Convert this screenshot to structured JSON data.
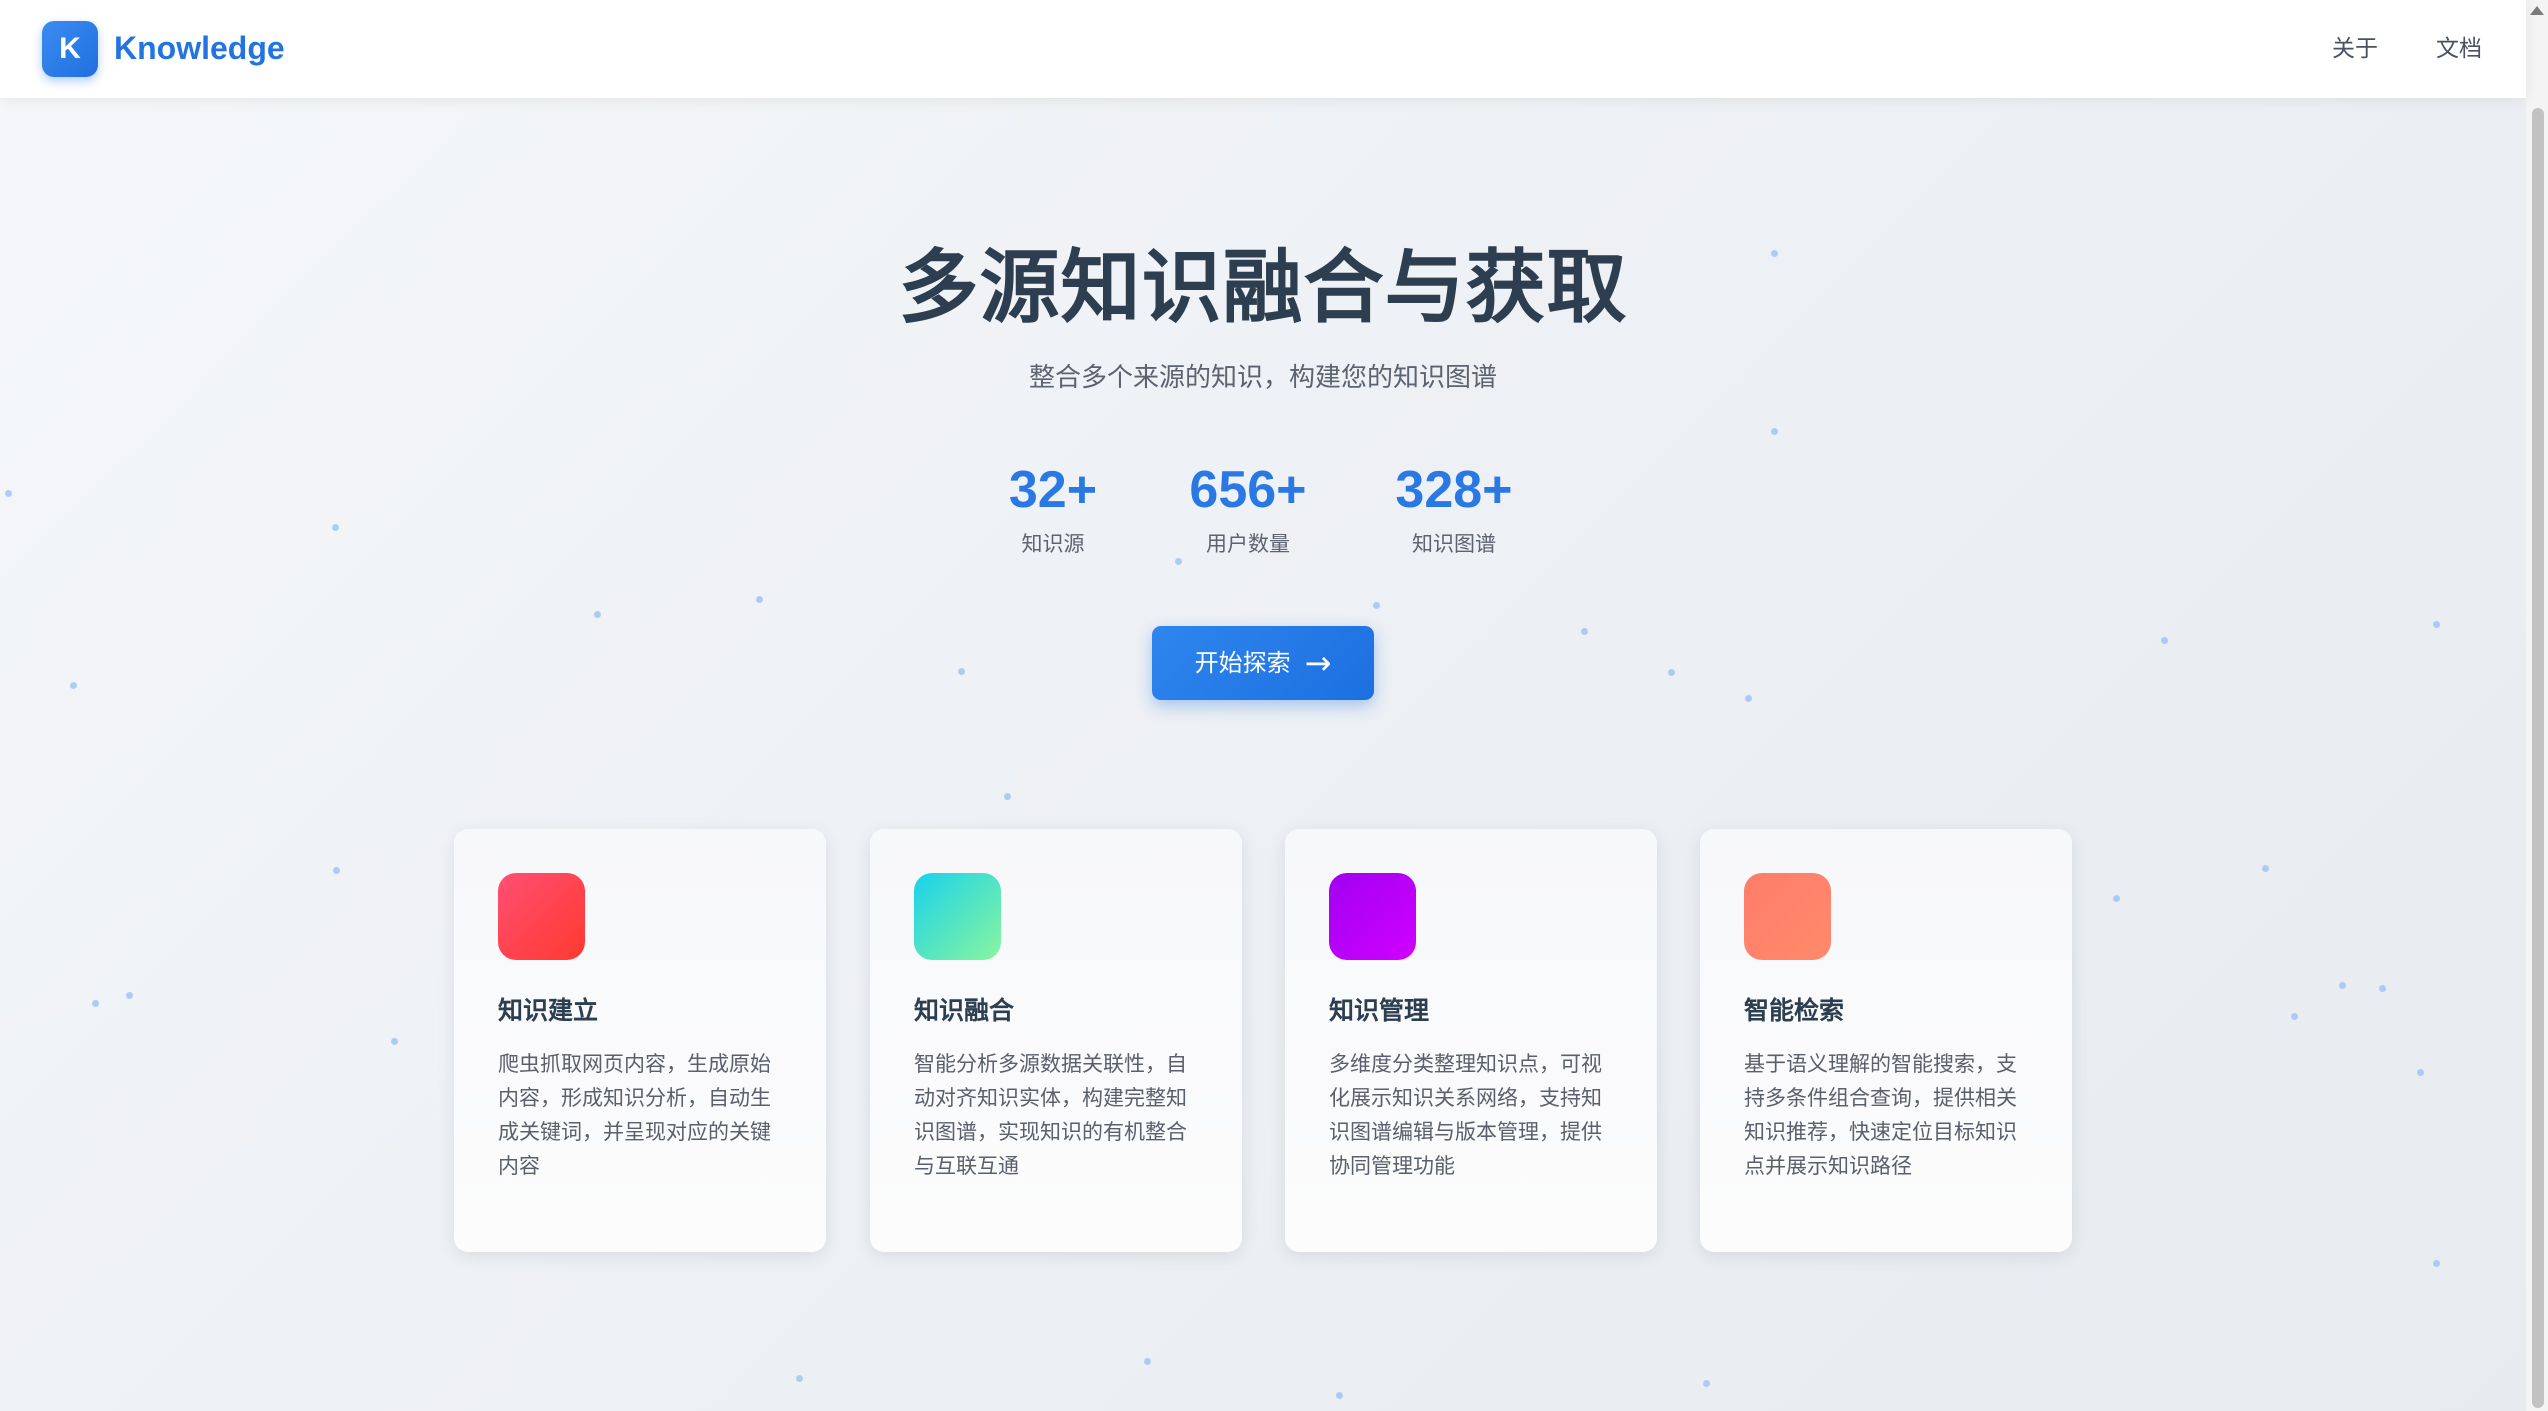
{
  "header": {
    "logo_letter": "K",
    "brand": "Knowledge",
    "nav": [
      {
        "label": "关于"
      },
      {
        "label": "文档"
      }
    ]
  },
  "hero": {
    "title": "多源知识融合与获取",
    "subtitle": "整合多个来源的知识，构建您的知识图谱",
    "stats": [
      {
        "value": "32+",
        "label": "知识源"
      },
      {
        "value": "656+",
        "label": "用户数量"
      },
      {
        "value": "328+",
        "label": "知识图谱"
      }
    ],
    "cta": {
      "label": "开始探索",
      "icon": "arrow-right-icon",
      "arrow": "→"
    }
  },
  "features": [
    {
      "title": "知识建立",
      "description": "爬虫抓取网页内容，生成原始内容，形成知识分析，自动生成关键词，并呈现对应的关键内容",
      "icon_gradient": [
        "#ff4f73",
        "#ff3a2f"
      ]
    },
    {
      "title": "知识融合",
      "description": "智能分析多源数据关联性，自动对齐知识实体，构建完整知识图谱，实现知识的有机整合与互联互通",
      "icon_gradient": [
        "#18d2ec",
        "#8af59e"
      ]
    },
    {
      "title": "知识管理",
      "description": "多维度分类整理知识点，可视化展示知识关系网络，支持知识图谱编辑与版本管理，提供协同管理功能",
      "icon_gradient": [
        "#a100f0",
        "#d000ff"
      ]
    },
    {
      "title": "智能检索",
      "description": "基于语义理解的智能搜索，支持多条件组合查询，提供相关知识推荐，快速定位目标知识点并展示知识路径",
      "icon_gradient": [
        "#ff7d6a",
        "#ff8a6a"
      ]
    }
  ],
  "colors": {
    "accent": "#2a78e4",
    "title": "#2c3e50",
    "particle": "#9bbdf2"
  }
}
